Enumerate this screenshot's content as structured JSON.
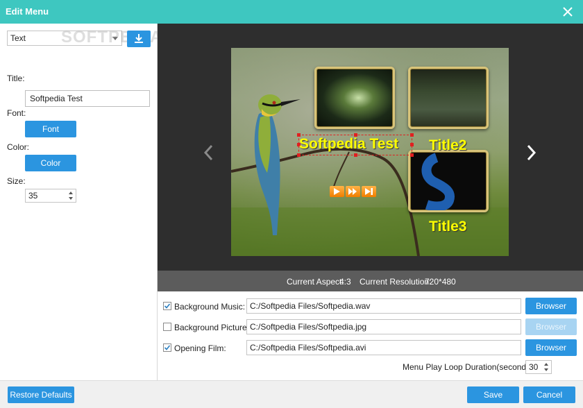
{
  "window": {
    "title": "Edit Menu",
    "close_icon": "close-icon"
  },
  "colors": {
    "titlebar": "#3ec7c0",
    "accent_button": "#2b95e0",
    "disabled_button": "#a8d4f2",
    "menu_text": "#ffff00",
    "selection": "#e02020"
  },
  "left_panel": {
    "type_select_value": "Text",
    "watermark": "SOFTPEDIA",
    "title_label": "Title:",
    "title_value": "Softpedia Test",
    "font_label": "Font:",
    "font_button": "Font",
    "color_label": "Color:",
    "color_button": "Color",
    "size_label": "Size:",
    "size_value": "35"
  },
  "preview": {
    "menu_title": "Softpedia Test",
    "title2": "Title2",
    "title3": "Title3",
    "controls": [
      "play-icon",
      "fast-forward-icon",
      "skip-end-icon"
    ]
  },
  "info": {
    "aspect_label": "Current Aspect:",
    "aspect_value": "4:3",
    "resolution_label": "Current Resolution:",
    "resolution_value": "720*480"
  },
  "options": [
    {
      "label": "Background Music:",
      "checked": true,
      "path": "C:/Softpedia Files/Softpedia.wav",
      "button": "Browser",
      "enabled": true
    },
    {
      "label": "Background Picture:",
      "checked": false,
      "path": "C:/Softpedia Files/Softpedia.jpg",
      "button": "Browser",
      "enabled": false
    },
    {
      "label": "Opening Film:",
      "checked": true,
      "path": "C:/Softpedia Files/Softpedia.avi",
      "button": "Browser",
      "enabled": true
    }
  ],
  "loop": {
    "label": "Menu Play Loop Duration(seconds):",
    "value": "30"
  },
  "footer": {
    "restore_button": "Restore Defaults",
    "save_button": "Save",
    "cancel_button": "Cancel"
  }
}
